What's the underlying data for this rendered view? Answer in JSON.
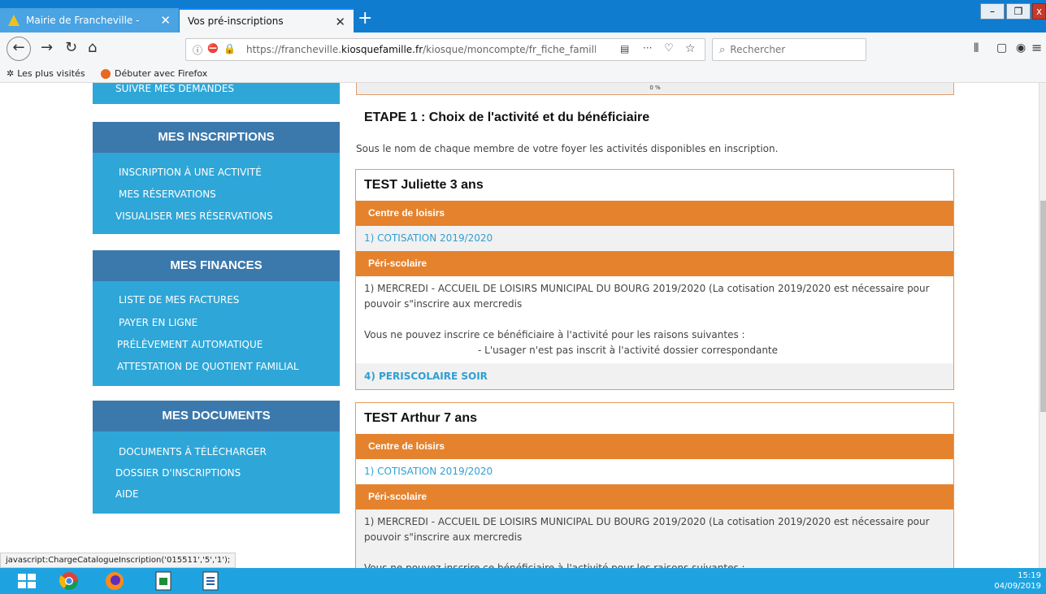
{
  "browser": {
    "tabs": [
      {
        "title": "Mairie de Francheville -",
        "active": false
      },
      {
        "title": "Vos pré-inscriptions",
        "active": true
      }
    ],
    "new_tab": "+",
    "window_controls": {
      "minimize": "–",
      "maximize": "❐",
      "close": "x"
    },
    "url_prefix": "https://francheville.",
    "url_domain": "kiosquefamille.fr",
    "url_suffix": "/kiosque/moncompte/fr_fiche_famille.j",
    "search_placeholder": "Rechercher",
    "bookmarks": [
      "Les plus visités",
      "Débuter avec Firefox"
    ],
    "accent": "#0f7cd0"
  },
  "sidebar": {
    "top_item": "SUIVRE MES DEMANDES",
    "sections": [
      {
        "title": "MES INSCRIPTIONS",
        "items": [
          "INSCRIPTION À UNE ACTIVITÉ",
          "MES RÉSERVATIONS",
          "VISUALISER MES RÉSERVATIONS"
        ]
      },
      {
        "title": "MES FINANCES",
        "items": [
          "LISTE DE MES FACTURES",
          "PAYER EN LIGNE",
          "PRÉLÈVEMENT AUTOMATIQUE",
          "ATTESTATION DE QUOTIENT FAMILIAL"
        ]
      },
      {
        "title": "MES DOCUMENTS",
        "items": [
          "DOCUMENTS À TÉLÉCHARGER",
          "DOSSIER D'INSCRIPTIONS",
          "AIDE"
        ]
      }
    ],
    "colors": {
      "header": "#3b79ad",
      "body": "#2ea6d8"
    }
  },
  "main": {
    "progress_label": "0 %",
    "progress_value": 0,
    "step_title": "ETAPE 1 : Choix de l'activité et du bénéficiaire",
    "step_description": "Sous le nom de chaque membre de votre foyer les activités disponibles en inscription.",
    "children": [
      {
        "name": "TEST Juliette 3 ans",
        "cat1": "Centre de loisirs",
        "cat1_activity": "1) COTISATION 2019/2020",
        "cat2": "Péri-scolaire",
        "activity_line1": "1) MERCREDI - ACCUEIL DE LOISIRS MUNICIPAL DU BOURG 2019/2020 (La cotisation 2019/2020 est nécessaire pour",
        "activity_line2": "pouvoir s\"inscrire aux mercredis",
        "reason_intro": "Vous ne pouvez inscrire ce bénéficiaire à l'activité pour les raisons suivantes :",
        "reason_detail": "- L'usager n'est pas inscrit à l'activité dossier correspondante",
        "extra_activity": "4) PERISCOLAIRE SOIR"
      },
      {
        "name": "TEST Arthur 7 ans",
        "cat1": "Centre de loisirs",
        "cat1_activity": "1) COTISATION 2019/2020",
        "cat2": "Péri-scolaire",
        "activity_line1": "1) MERCREDI - ACCUEIL DE LOISIRS MUNICIPAL DU BOURG 2019/2020 (La cotisation 2019/2020 est nécessaire pour",
        "activity_line2": "pouvoir s\"inscrire aux mercredis",
        "reason_intro": "Vous ne pouvez inscrire ce bénéficiaire à l'activité pour les raisons suivantes :"
      }
    ],
    "colors": {
      "category_bar": "#e5822d",
      "link": "#2f9fd3",
      "card_border": "#e89a55"
    }
  },
  "status_text": "javascript:ChargeCatalogueInscription('015511','5','1');",
  "taskbar": {
    "time": "15:19",
    "date": "04/09/2019",
    "apps": [
      "windows-start",
      "chrome",
      "firefox",
      "spreadsheet",
      "document"
    ]
  }
}
